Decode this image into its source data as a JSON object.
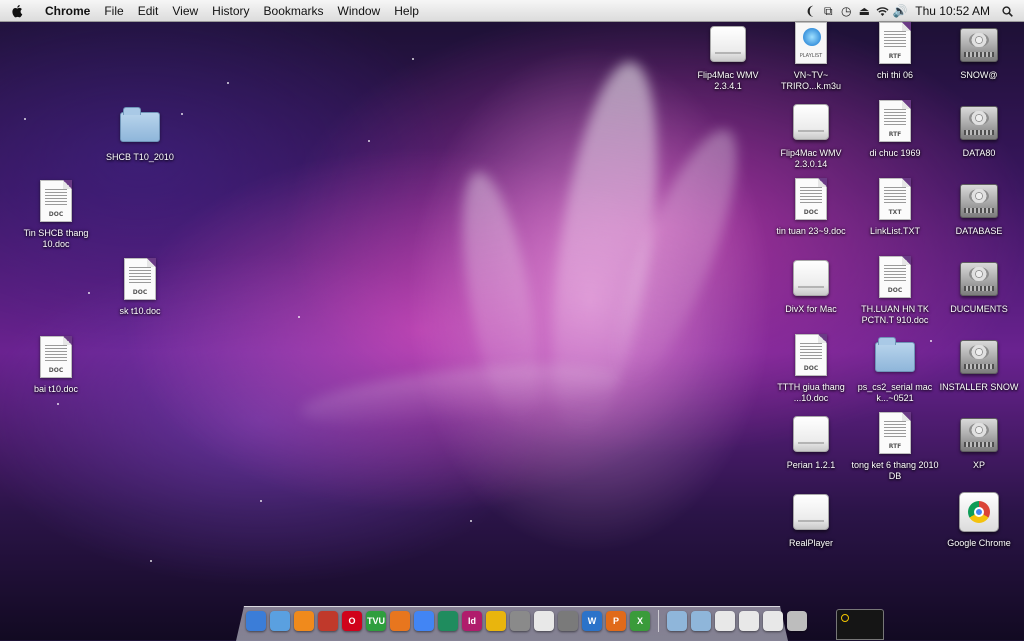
{
  "menubar": {
    "app_name": "Chrome",
    "menus": [
      "File",
      "Edit",
      "View",
      "History",
      "Bookmarks",
      "Window",
      "Help"
    ],
    "clock": "Thu 10:52 AM",
    "status_icons": [
      "script-menu-icon",
      "sync-icon",
      "time-machine-icon",
      "eject-icon",
      "wifi-icon",
      "volume-icon"
    ],
    "spotlight_icon": "spotlight-search-icon"
  },
  "desktop": {
    "left_icons": [
      {
        "label": "SHCB T10_2010",
        "type": "folder"
      },
      {
        "label": "Tin SHCB thang 10.doc",
        "type": "doc",
        "tag": "DOC"
      },
      {
        "label": "sk t10.doc",
        "type": "doc",
        "tag": "DOC"
      },
      {
        "label": "bai t10.doc",
        "type": "doc",
        "tag": "DOC"
      }
    ],
    "col1": [
      {
        "label": "Flip4Mac WMV 2.3.4.1",
        "type": "disk"
      }
    ],
    "col2": [
      {
        "label": "VN~TV~ TRIRO...k.m3u",
        "type": "playlist",
        "tag": "PLAYLIST"
      },
      {
        "label": "Flip4Mac WMV 2.3.0.14",
        "type": "disk"
      },
      {
        "label": "tin tuan 23~9.doc",
        "type": "doc",
        "tag": "DOC"
      },
      {
        "label": "DivX for Mac",
        "type": "disk"
      },
      {
        "label": "TTTH giua thang ...10.doc",
        "type": "doc",
        "tag": "DOC"
      },
      {
        "label": "Perian 1.2.1",
        "type": "disk"
      },
      {
        "label": "RealPlayer",
        "type": "disk"
      }
    ],
    "col3": [
      {
        "label": "chi thi 06",
        "type": "doc",
        "tag": "RTF"
      },
      {
        "label": "di chuc 1969",
        "type": "doc",
        "tag": "RTF"
      },
      {
        "label": "LinkList.TXT",
        "type": "doc",
        "tag": "TXT"
      },
      {
        "label": "TH.LUAN HN TK PCTN.T 910.doc",
        "type": "doc",
        "tag": "DOC"
      },
      {
        "label": "ps_cs2_serial mac k...~0521",
        "type": "folder"
      },
      {
        "label": "tong ket 6 thang 2010 DB",
        "type": "doc",
        "tag": "RTF"
      }
    ],
    "col4": [
      {
        "label": "SNOW@",
        "type": "hdd"
      },
      {
        "label": "DATA80",
        "type": "hdd"
      },
      {
        "label": "DATABASE",
        "type": "hdd"
      },
      {
        "label": "DUCUMENTS",
        "type": "hdd"
      },
      {
        "label": "INSTALLER SNOW",
        "type": "hdd"
      },
      {
        "label": "XP",
        "type": "hdd"
      },
      {
        "label": "Google Chrome",
        "type": "chrome"
      }
    ]
  },
  "dock": {
    "apps": [
      {
        "name": "finder-icon",
        "text": "",
        "color": "#3b7dd8"
      },
      {
        "name": "safari-icon",
        "text": "",
        "color": "#5aa0e0"
      },
      {
        "name": "vlc-icon",
        "text": "",
        "color": "#f08a1c"
      },
      {
        "name": "joystick-icon",
        "text": "",
        "color": "#c0392b"
      },
      {
        "name": "opera-icon",
        "text": "O",
        "color": "#d0021b"
      },
      {
        "name": "tvu-icon",
        "text": "TVU",
        "color": "#2e9e3e"
      },
      {
        "name": "firefox-icon",
        "text": "",
        "color": "#e8761e"
      },
      {
        "name": "chrome-icon",
        "text": "",
        "color": "#4285f4"
      },
      {
        "name": "dreamweaver-icon",
        "text": "",
        "color": "#1f8c5e"
      },
      {
        "name": "indesign-icon",
        "text": "Id",
        "color": "#b01c6c"
      },
      {
        "name": "adium-icon",
        "text": "",
        "color": "#e9b50d"
      },
      {
        "name": "preview-icon",
        "text": "",
        "color": "#8a8a8a"
      },
      {
        "name": "textedit-icon",
        "text": "",
        "color": "#e8e8e8"
      },
      {
        "name": "system-prefs-icon",
        "text": "",
        "color": "#7a7a7a"
      },
      {
        "name": "word-icon",
        "text": "W",
        "color": "#2b73c9"
      },
      {
        "name": "powerpoint-icon",
        "text": "P",
        "color": "#e06a1a"
      },
      {
        "name": "excel-icon",
        "text": "X",
        "color": "#3a9b3a"
      }
    ],
    "stacks": [
      {
        "name": "applications-stack-icon",
        "color": "#8fb6da"
      },
      {
        "name": "documents-stack-icon",
        "color": "#8fb6da"
      },
      {
        "name": "downloads-stack-icon",
        "color": "#e8e8e8"
      },
      {
        "name": "document-stack-icon",
        "color": "#e8e8e8"
      },
      {
        "name": "folder-stack-icon",
        "color": "#e8e8e8"
      },
      {
        "name": "trash-icon",
        "color": "#bdbdbd"
      }
    ]
  }
}
